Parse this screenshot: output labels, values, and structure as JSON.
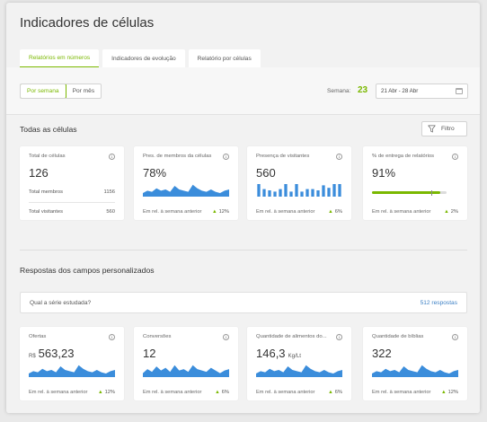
{
  "page": {
    "title": "Indicadores de células"
  },
  "tabs": [
    {
      "label": "Relatórios em números",
      "active": true
    },
    {
      "label": "Indicadores de evolução",
      "active": false
    },
    {
      "label": "Relatório por células",
      "active": false
    }
  ],
  "period": {
    "options": [
      {
        "label": "Por semana",
        "active": true
      },
      {
        "label": "Por mês",
        "active": false
      }
    ],
    "week_label": "Semana:",
    "week_number": "23",
    "date_range": "21 Abr - 28 Abr",
    "calendar_icon": "calendar-icon"
  },
  "colors": {
    "accent": "#7ab800",
    "spark_fill": "#3b8ddb",
    "link": "#3b7fc4"
  },
  "all_cells": {
    "title": "Todas as células",
    "filter_label": "Filtro",
    "filter_icon": "funnel-icon",
    "cards": [
      {
        "label": "Total de células",
        "value": "126",
        "rows": [
          {
            "label": "Total membros",
            "value": "1156"
          },
          {
            "label": "Total visitantes",
            "value": "560"
          }
        ]
      },
      {
        "label": "Pres. de membros da células",
        "value": "78%",
        "compare_label": "Em rel. à semana anterior",
        "trend": "12%",
        "spark": [
          3,
          5,
          4,
          7,
          5,
          6,
          4,
          9,
          6,
          5,
          4,
          10,
          7,
          5,
          4,
          6,
          4,
          3,
          5,
          6
        ]
      },
      {
        "label": "Presença de visitantes",
        "value": "560",
        "compare_label": "Em rel. à semana anterior",
        "trend": "6%",
        "bars": [
          10,
          6,
          5,
          4,
          6,
          10,
          4,
          10,
          4,
          6,
          6,
          5,
          9,
          7,
          10,
          10
        ]
      },
      {
        "label": "% de entrega de relatórios",
        "value": "91%",
        "compare_label": "Em rel. à semana anterior",
        "trend": "2%",
        "progress": 0.91,
        "target": 0.8
      }
    ]
  },
  "custom_fields": {
    "title": "Respostas dos campos personalizados",
    "question": "Qual a série estudada?",
    "responses": "512 respostas",
    "cards": [
      {
        "label": "Ofertas",
        "prefix": "R$",
        "value": "563,23",
        "unit": "",
        "compare_label": "Em rel. à semana anterior",
        "trend": "12%",
        "spark": [
          3,
          5,
          4,
          7,
          5,
          6,
          4,
          9,
          6,
          5,
          4,
          10,
          7,
          5,
          4,
          6,
          4,
          3,
          5,
          6
        ]
      },
      {
        "label": "Conversões",
        "prefix": "",
        "value": "12",
        "unit": "",
        "compare_label": "Em rel. à semana anterior",
        "trend": "6%",
        "spark": [
          3,
          6,
          4,
          8,
          5,
          7,
          4,
          9,
          5,
          6,
          4,
          9,
          6,
          5,
          4,
          7,
          5,
          3,
          5,
          6
        ]
      },
      {
        "label": "Quantidade de alimentos do...",
        "prefix": "",
        "value": "146,3",
        "unit": "Kg/Lt",
        "compare_label": "Em rel. à semana anterior",
        "trend": "6%",
        "spark": [
          3,
          5,
          4,
          7,
          5,
          6,
          4,
          9,
          6,
          5,
          4,
          10,
          7,
          5,
          4,
          6,
          4,
          3,
          5,
          6
        ]
      },
      {
        "label": "Quantidade de bíblias",
        "prefix": "",
        "value": "322",
        "unit": "",
        "compare_label": "Em rel. à semana anterior",
        "trend": "12%",
        "spark": [
          3,
          5,
          4,
          7,
          5,
          6,
          4,
          9,
          6,
          5,
          4,
          10,
          7,
          5,
          4,
          6,
          4,
          3,
          5,
          6
        ]
      }
    ]
  }
}
